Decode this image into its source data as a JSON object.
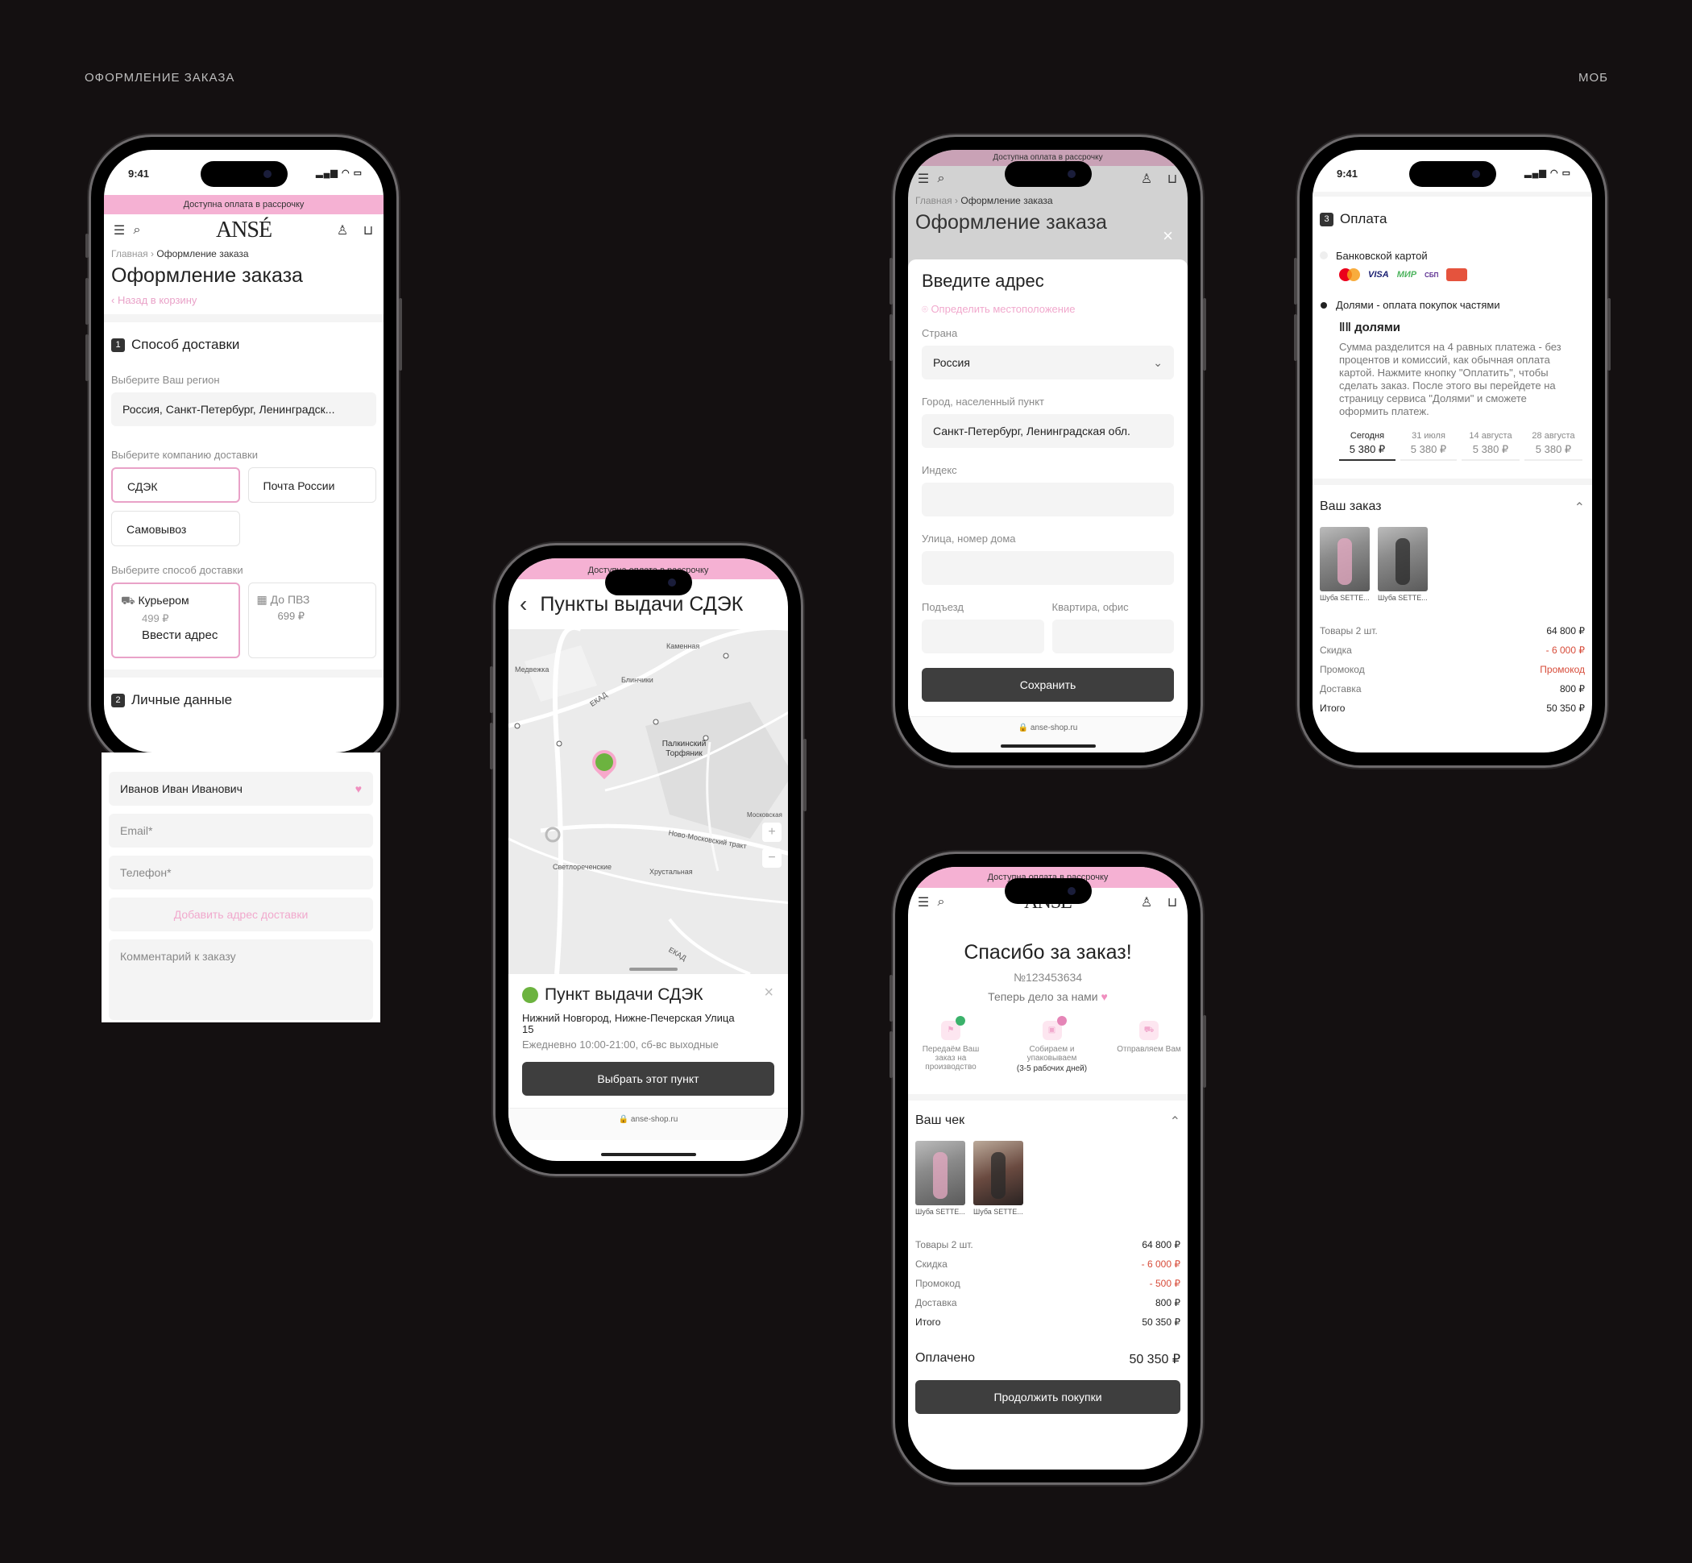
{
  "header": {
    "left": "ОФОРМЛЕНИЕ ЗАКАЗА",
    "right": "МОБ"
  },
  "status": {
    "time": "9:41",
    "indicators": "▂▄▆ ◠ ▭"
  },
  "banner": "Доступна оплата в рассрочку",
  "logo": "ANSÉ",
  "screen1": {
    "crumb_home": "Главная",
    "crumb_sep": "›",
    "crumb_current": "Оформление заказа",
    "title": "Оформление заказа",
    "back": "‹  Назад в корзину",
    "step1_num": "1",
    "step1": "Способ доставки",
    "region_label": "Выберите Ваш регион",
    "region_value": "Россия, Санкт-Петербург, Ленинградск...",
    "company_label": "Выберите компанию доставки",
    "companies": [
      "СДЭК",
      "Почта России",
      "Самовывоз"
    ],
    "method_label": "Выберите способ доставки",
    "courier": {
      "name": "Курьером",
      "price": "499 ₽",
      "action": "Ввести адрес"
    },
    "pvz": {
      "name": "До ПВЗ",
      "price": "699 ₽"
    },
    "step2_num": "2",
    "step2": "Личные данные",
    "name_value": "Иванов Иван Иванович",
    "email_ph": "Email*",
    "phone_ph": "Телефон*",
    "add_address": "Добавить адрес доставки",
    "comment_ph": "Комментарий к заказу"
  },
  "screen2": {
    "title": "Пункты выдачи СДЭК",
    "map_labels": [
      "Каменная",
      "Медвежка",
      "Блинчики",
      "ЕКАД",
      "Палкинский Торфяник",
      "Светлореченские",
      "Хрустальная",
      "Ново-Московский тракт",
      "ЕКАД",
      "Московская"
    ],
    "card_title": "Пункт выдачи СДЭК",
    "card_address": "Нижний Новгород, Нижне-Печерская Улица 15",
    "card_hours": "Ежедневно 10:00-21:00, сб-вс выходные",
    "card_button": "Выбрать этот пункт",
    "url": "🔒 anse-shop.ru",
    "zoom_in": "+",
    "zoom_out": "−",
    "close": "×",
    "back": "‹"
  },
  "screen3": {
    "crumb_home": "Главная",
    "crumb_sep": "›",
    "crumb_current": "Оформление заказа",
    "title": "Оформление заказа",
    "close": "×",
    "modal_title": "Введите адрес",
    "locate": "Определить местоположение",
    "country_label": "Страна",
    "country_value": "Россия",
    "city_label": "Город, населенный пункт",
    "city_value": "Санкт-Петербург, Ленинградская обл.",
    "index_label": "Индекс",
    "street_label": "Улица, номер дома",
    "entrance_label": "Подъезд",
    "flat_label": "Квартира, офис",
    "save": "Сохранить",
    "url": "🔒 anse-shop.ru"
  },
  "screen4": {
    "step3_num": "3",
    "step3": "Оплата",
    "card_option": "Банковской картой",
    "pay_logos": [
      "VISA",
      "МИР",
      "СБП"
    ],
    "dolyami_option": "Долями - оплата покупок частями",
    "dolyami_logo": "долями",
    "dolyami_text": "Сумма разделится на 4 равных платежа - без процентов и комиссий, как обычная оплата картой. Нажмите кнопку \"Оплатить\", чтобы сделать заказ. После этого вы перейдете на страницу сервиса \"Долями\" и сможете оформить платеж.",
    "schedule": [
      {
        "date": "Сегодня",
        "amount": "5 380 ₽"
      },
      {
        "date": "31 июля",
        "amount": "5 380 ₽"
      },
      {
        "date": "14 августа",
        "amount": "5 380 ₽"
      },
      {
        "date": "28 августа",
        "amount": "5 380 ₽"
      }
    ],
    "order_title": "Ваш заказ",
    "items": [
      "Шуба SETTE...",
      "Шуба SETTE..."
    ],
    "summary": [
      {
        "label": "Товары 2 шт.",
        "value": "64 800 ₽"
      },
      {
        "label": "Скидка",
        "value": "- 6 000 ₽"
      },
      {
        "label": "Промокод",
        "value": "Промокод"
      },
      {
        "label": "Доставка",
        "value": "800 ₽"
      },
      {
        "label": "Итого",
        "value": "50 350 ₽"
      }
    ]
  },
  "screen5": {
    "title": "Спасибо за заказ!",
    "order_no": "№123453634",
    "subtitle": "Теперь дело за нами",
    "steps": [
      "Передаём Ваш заказ на производство",
      "Собираем и упаковываем",
      "Отправляем Вам"
    ],
    "steps_note": "(3-5 рабочих дней)",
    "check_title": "Ваш чек",
    "items": [
      "Шуба SETTE...",
      "Шуба SETTE..."
    ],
    "summary": [
      {
        "label": "Товары 2 шт.",
        "value": "64 800 ₽"
      },
      {
        "label": "Скидка",
        "value": "- 6 000 ₽"
      },
      {
        "label": "Промокод",
        "value": "- 500 ₽"
      },
      {
        "label": "Доставка",
        "value": "800 ₽"
      },
      {
        "label": "Итого",
        "value": "50 350 ₽"
      }
    ],
    "paid_label": "Оплачено",
    "paid_value": "50 350 ₽",
    "continue": "Продолжить покупки"
  },
  "colors": {
    "background": "#141011",
    "pink": "#f5b1d3",
    "accent_pink": "#e9a2c8",
    "button": "#3e3e3e",
    "red": "#d74c3a"
  }
}
